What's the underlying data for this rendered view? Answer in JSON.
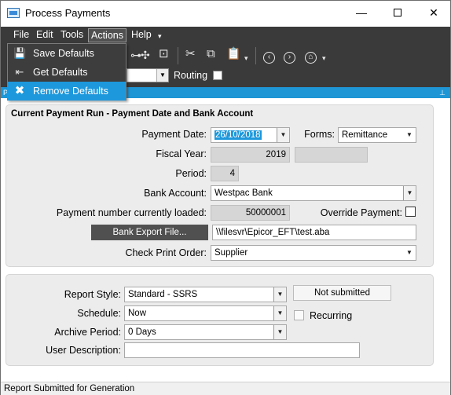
{
  "window": {
    "title": "Process Payments",
    "minimize_glyph": "—",
    "close_glyph": "✕"
  },
  "menubar": {
    "items": [
      "File",
      "Edit",
      "Tools",
      "Actions",
      "Help"
    ],
    "active": "Actions",
    "help_chevron": "▾"
  },
  "actions_menu": {
    "items": [
      {
        "label": "Save Defaults",
        "icon": "save-icon"
      },
      {
        "label": "Get Defaults",
        "icon": "get-defaults-icon"
      },
      {
        "label": "Remove Defaults",
        "icon": "remove-icon",
        "highlighted": true
      }
    ]
  },
  "toolbar": {
    "routing_label": "Routing",
    "routing_checked": false,
    "combo_value": ""
  },
  "tab_strip": {
    "left_letter": "P",
    "pin_glyph": "📌"
  },
  "payment_run": {
    "title": "Current Payment Run - Payment Date and Bank Account",
    "payment_date_label": "Payment Date:",
    "payment_date_value": "26/10/2018",
    "forms_label": "Forms:",
    "forms_value": "Remittance",
    "fiscal_year_label": "Fiscal Year:",
    "fiscal_year_value": "2019",
    "fiscal_year_extra": "",
    "period_label": "Period:",
    "period_value": "4",
    "bank_account_label": "Bank Account:",
    "bank_account_value": "Westpac Bank",
    "payment_number_label": "Payment number currently loaded:",
    "payment_number_value": "50000001",
    "override_label": "Override Payment:",
    "override_checked": false,
    "bank_export_button": "Bank Export File...",
    "bank_export_path": "\\\\filesvr\\Epicor_EFT\\test.aba",
    "check_print_order_label": "Check Print Order:",
    "check_print_order_value": "Supplier"
  },
  "report": {
    "report_style_label": "Report Style:",
    "report_style_value": "Standard - SSRS",
    "status": "Not submitted",
    "schedule_label": "Schedule:",
    "schedule_value": "Now",
    "recurring_label": "Recurring",
    "recurring_checked": false,
    "archive_period_label": "Archive Period:",
    "archive_period_value": "0 Days",
    "user_description_label": "User Description:",
    "user_description_value": ""
  },
  "statusbar": {
    "text": "Report Submitted for Generation"
  },
  "colors": {
    "accent": "#1e96d6",
    "menu_bg": "#3a3a3a",
    "panel_bg": "#ececec",
    "button_bg": "#505050"
  }
}
